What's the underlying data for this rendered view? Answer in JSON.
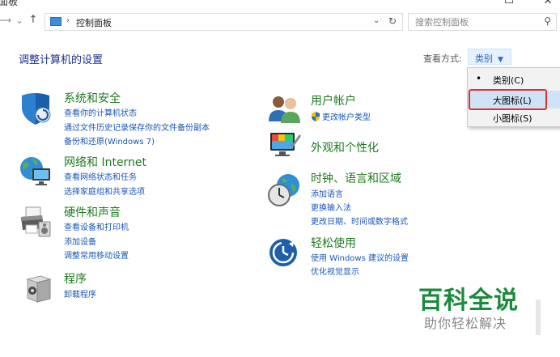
{
  "window": {
    "title_fragment": "面板",
    "minimize_glyph": "▭",
    "close_glyph": "✕"
  },
  "nav": {
    "back_glyph": "←",
    "forward_glyph": "→",
    "dropdown_glyph": "⌄",
    "up_glyph": "↑"
  },
  "address": {
    "separator": "›",
    "path": "控制面板",
    "dropdown_glyph": "⌄",
    "refresh_glyph": "↻"
  },
  "search": {
    "placeholder": "搜索控制面板",
    "icon_glyph": "⚲"
  },
  "page": {
    "title": "调整计算机的设置",
    "view_label": "查看方式:",
    "view_value": "类别",
    "view_caret": "▼"
  },
  "view_menu": {
    "items": [
      {
        "label": "类别(C)",
        "selected": true,
        "dot": "•"
      },
      {
        "label": "大图标(L)",
        "highlighted": true
      },
      {
        "label": "小图标(S)"
      }
    ]
  },
  "categories_left": [
    {
      "title": "系统和安全",
      "icon": "shield-icon",
      "links": [
        "查看你的计算机状态",
        "通过文件历史记录保存你的文件备份副本",
        "备份和还原(Windows 7)"
      ]
    },
    {
      "title": "网络和 Internet",
      "icon": "network-icon",
      "links": [
        "查看网络状态和任务",
        "选择家庭组和共享选项"
      ]
    },
    {
      "title": "硬件和声音",
      "icon": "printer-icon",
      "links": [
        "查看设备和打印机",
        "添加设备",
        "调整常用移动设置"
      ]
    },
    {
      "title": "程序",
      "icon": "programs-icon",
      "links": [
        "卸载程序"
      ]
    }
  ],
  "categories_right": [
    {
      "title": "用户帐户",
      "icon": "users-icon",
      "links": [
        "更改帐户类型"
      ]
    },
    {
      "title": "外观和个性化",
      "icon": "appearance-icon",
      "links": []
    },
    {
      "title": "时钟、语言和区域",
      "icon": "clock-globe-icon",
      "links": [
        "添加语言",
        "更换输入法",
        "更改日期、时间或数字格式"
      ]
    },
    {
      "title": "轻松使用",
      "icon": "ease-of-access-icon",
      "links": [
        "使用 Windows 建议的设置",
        "优化视觉显示"
      ]
    }
  ],
  "watermark": {
    "main": "百科全说",
    "sub": "助你轻松解决"
  },
  "colors": {
    "category_title": "#1e7b1e",
    "link": "#1a56b8",
    "heading": "#1e3287",
    "highlight_box": "#e0312b",
    "watermark": "#1a8a3c"
  }
}
